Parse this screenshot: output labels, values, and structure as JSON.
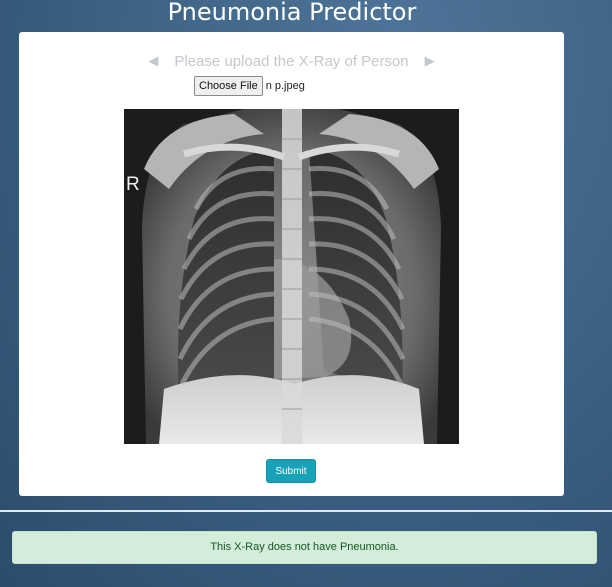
{
  "header": {
    "title": "Pneumonia Predictor"
  },
  "upload": {
    "prompt": "Please upload the X-Ray of Person",
    "prev_arrow": "◀",
    "next_arrow": "▶",
    "choose_file_label": "Choose File",
    "selected_file": "n p.jpeg"
  },
  "preview": {
    "marker_letter": "R"
  },
  "actions": {
    "submit_label": "Submit"
  },
  "result": {
    "message": "This X-Ray does not have Pneumonia."
  },
  "colors": {
    "page_background": "#3e6487",
    "submit_button": "#17a2b8",
    "result_background": "#d4edda",
    "result_text": "#155724"
  }
}
